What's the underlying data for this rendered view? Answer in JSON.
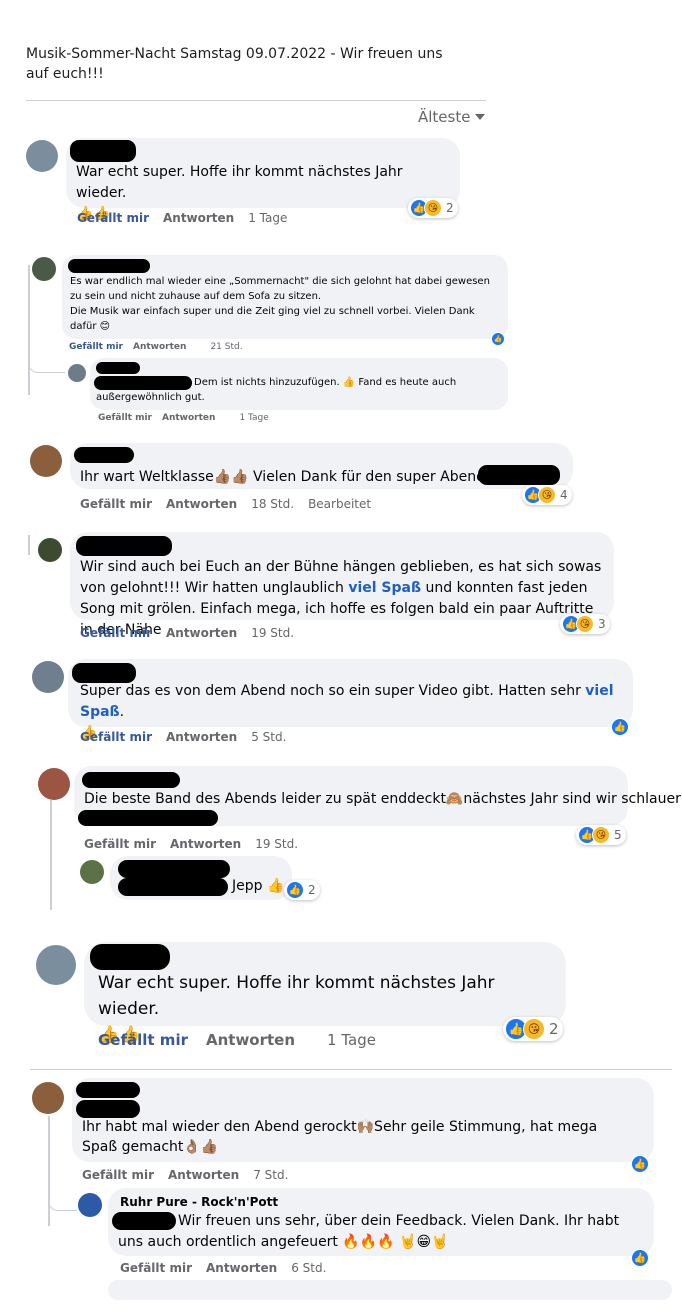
{
  "post": {
    "title": "Musik-Sommer-Nacht Samstag 09.07.2022 - Wir freuen uns auf euch!!!"
  },
  "sort": {
    "label": "Älteste",
    "icon": "caret-down-icon"
  },
  "labels": {
    "like": "Gefällt mir",
    "reply": "Antworten",
    "edited": "Bearbeitet"
  },
  "comments": [
    {
      "text": "War echt super. Hoffe ihr kommt nächstes Jahr wieder.",
      "emoji": "👍👍",
      "time": "1 Tage",
      "reactions": "2"
    },
    {
      "text": "Es war endlich mal wieder eine „Sommernacht\" die sich gelohnt hat dabei gewesen zu sein und nicht zuhause auf dem Sofa zu sitzen.",
      "text2": "Die Musik war einfach super und die Zeit ging viel zu schnell vorbei. Vielen Dank dafür",
      "emoji": "😊",
      "time": "21 Std."
    },
    {
      "text": "Dem ist nichts hinzuzufügen. 👍 Fand es heute auch außergewöhnlich gut.",
      "time": "1 Tage"
    },
    {
      "text": "Ihr wart Weltklasse👍🏽👍🏽 Vielen Dank für den super Abend🙏🏼",
      "time": "18 Std.",
      "reactions": "4"
    },
    {
      "text_a": "Wir sind auch bei Euch an der Bühne hängen geblieben, es hat sich sowas von gelohnt!!! Wir hatten unglaublich",
      "hl": "viel Spaß",
      "text_b": "und konnten fast jeden Song mit grölen. Einfach mega, ich hoffe es folgen bald ein paar Auftritte in der Nähe",
      "time": "19 Std.",
      "reactions": "3"
    },
    {
      "text_a": "Super das es von dem Abend noch so ein super Video gibt. Hatten sehr",
      "hl": "viel Spaß",
      "text_b": ".",
      "emoji": "👍",
      "time": "5 Std."
    },
    {
      "text": "Die beste Band des Abends leider zu spät enddeckt🙈nächstes Jahr sind wir schlauer",
      "time": "19 Std.",
      "reactions": "5"
    },
    {
      "text": "Jepp 👍",
      "reactions": "2"
    },
    {
      "text": "War echt super. Hoffe ihr kommt nächstes Jahr wieder.",
      "emoji": "👍👍",
      "time": "1 Tage",
      "reactions": "2"
    },
    {
      "text": "Ihr habt mal wieder den Abend gerockt🙌🏽Sehr geile Stimmung, hat mega Spaß gemacht👌🏽👍🏽",
      "time": "7 Std."
    },
    {
      "author": "Ruhr Pure - Rock'n'Pott",
      "text": "Wir freuen uns sehr, über dein Feedback. Vielen Dank. Ihr habt uns auch ordentlich angefeuert 🔥🔥🔥 🤘😁🤘",
      "time": "6 Std."
    }
  ]
}
